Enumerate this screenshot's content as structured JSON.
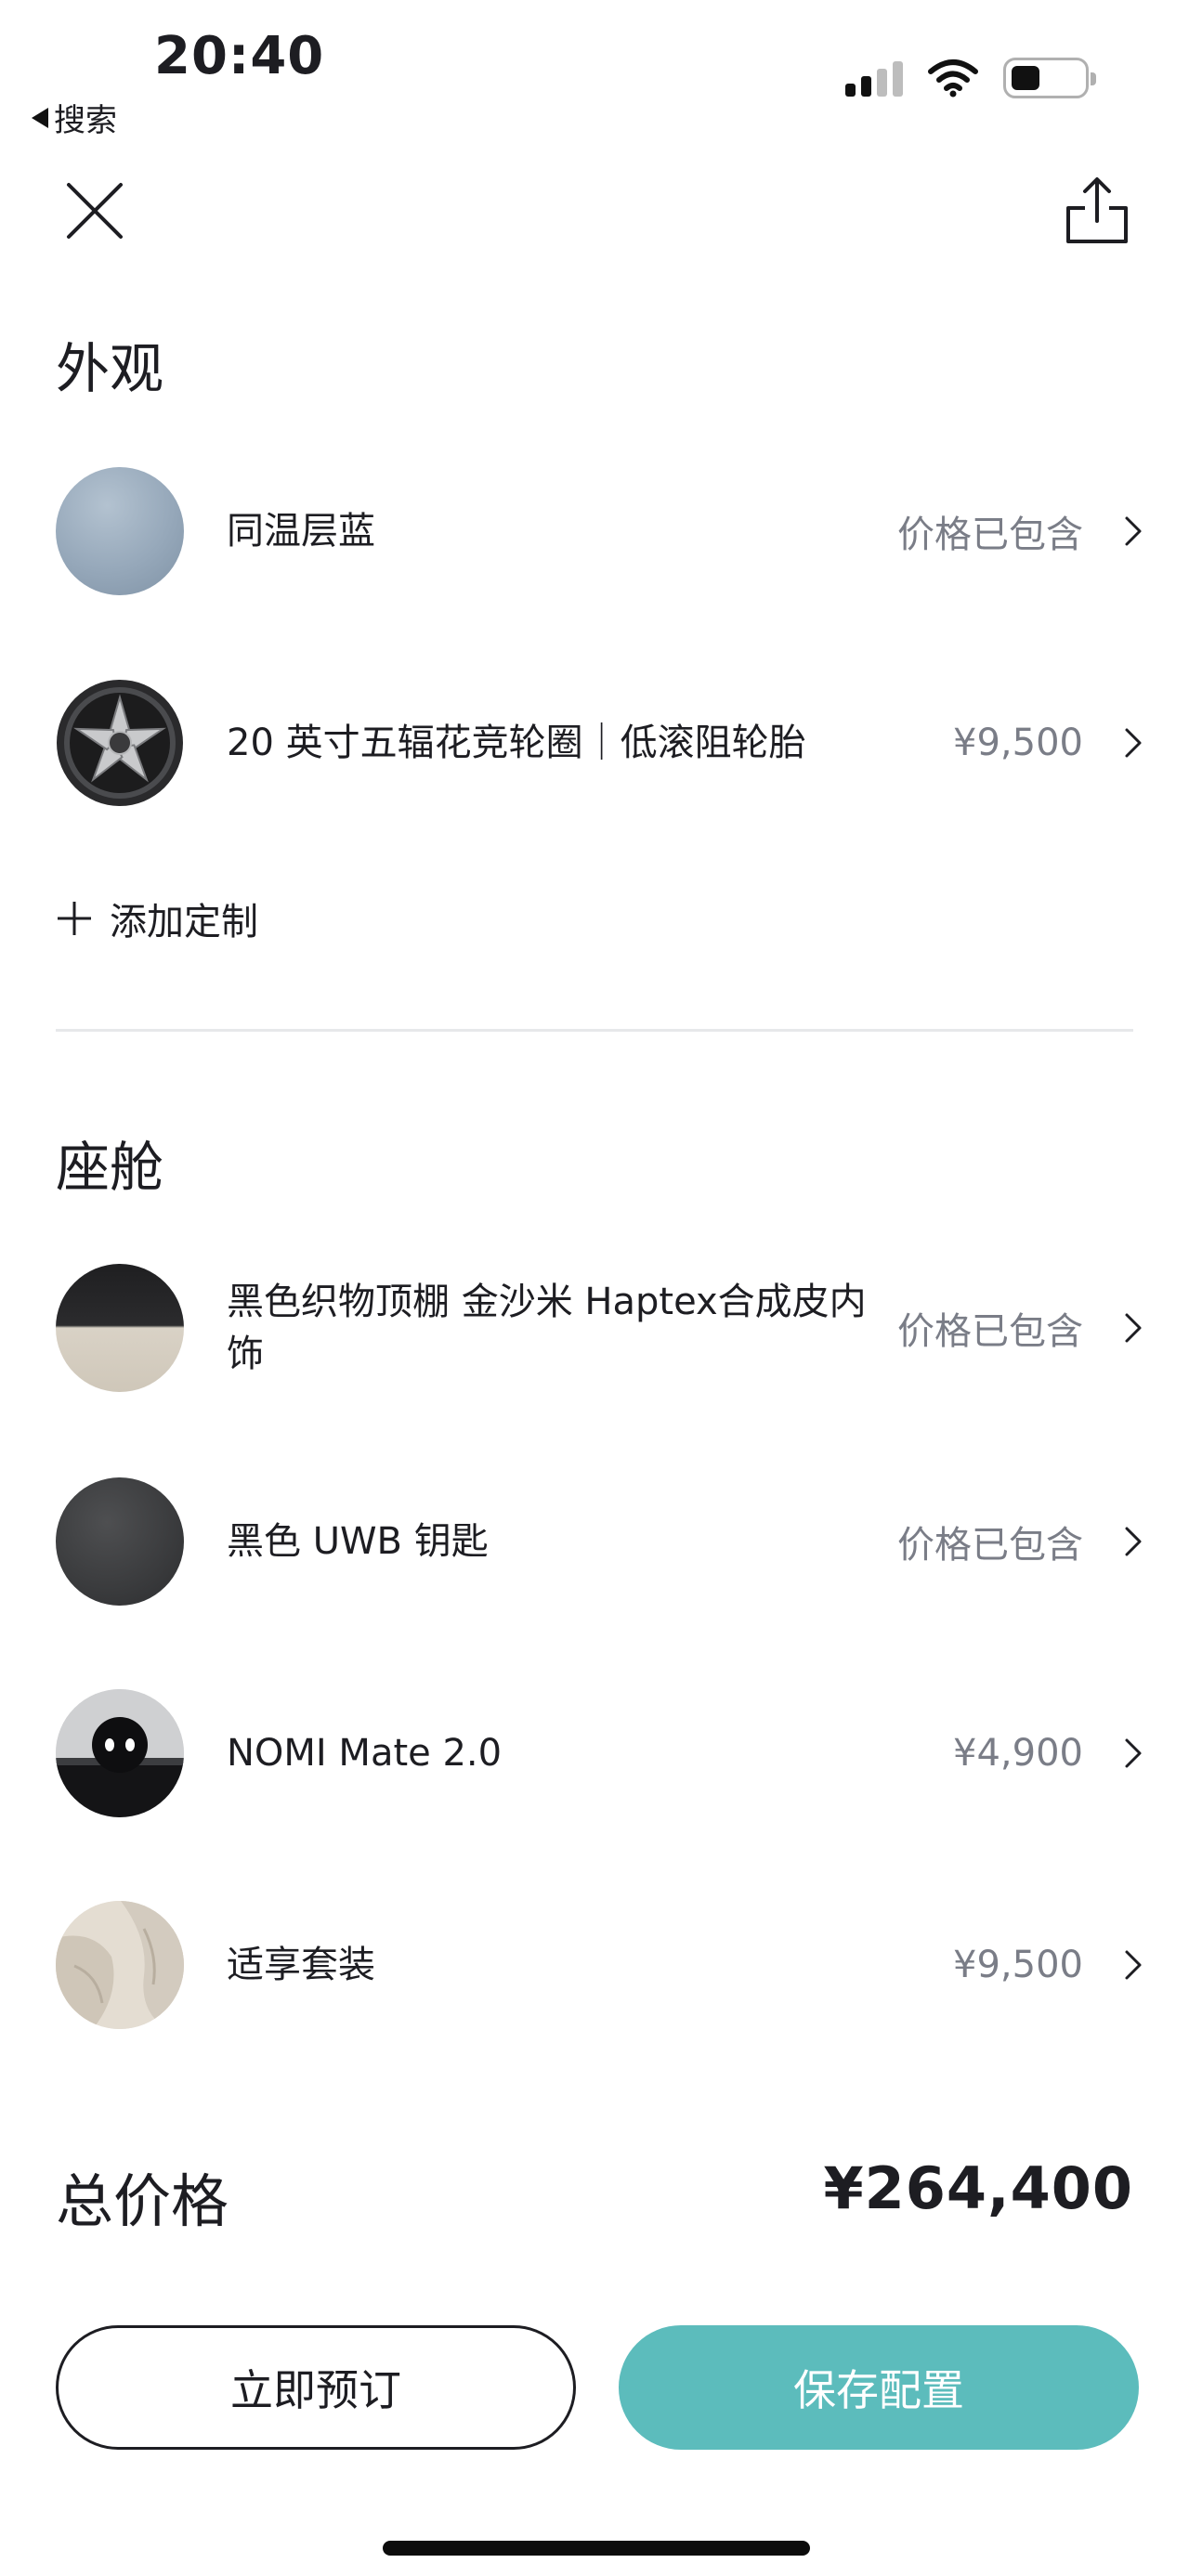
{
  "status_bar": {
    "time": "20:40",
    "back_label": "搜索"
  },
  "exterior": {
    "title": "外观",
    "items": [
      {
        "label": "同温层蓝",
        "price": "价格已包含",
        "thumb": "blue-paint-swatch"
      },
      {
        "label": "20 英寸五辐花竞轮圈｜低滚阻轮胎",
        "price": "¥9,500",
        "thumb": "wheel-rim-image"
      }
    ],
    "add_custom_label": "添加定制"
  },
  "cabin": {
    "title": "座舱",
    "items": [
      {
        "label": "黑色织物顶棚 金沙米 Haptex合成皮内饰",
        "price": "价格已包含",
        "thumb": "interior-material-swatch"
      },
      {
        "label": "黑色 UWB 钥匙",
        "price": "价格已包含",
        "thumb": "uwb-key-swatch"
      },
      {
        "label": "NOMI Mate 2.0",
        "price": "¥4,900",
        "thumb": "nomi-robot-image"
      },
      {
        "label": "适享套装",
        "price": "¥9,500",
        "thumb": "seat-package-image"
      }
    ]
  },
  "total": {
    "label": "总价格",
    "value": "¥264,400"
  },
  "buttons": {
    "reserve": "立即预订",
    "save": "保存配置"
  },
  "colors": {
    "accent": "#5cbcbc",
    "price_gray": "#7a7d87",
    "text": "#1d1d22"
  }
}
